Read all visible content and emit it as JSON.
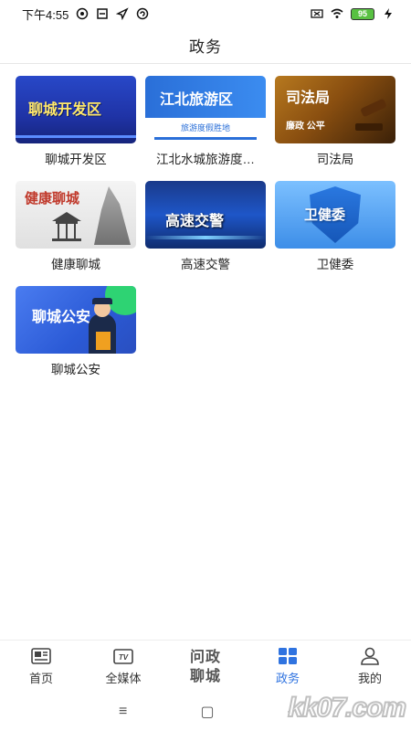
{
  "status_bar": {
    "time": "下午4:55",
    "battery": "95"
  },
  "header": {
    "title": "政务"
  },
  "tiles": [
    {
      "label": "聊城开发区",
      "thumb_text": "聊城开发区"
    },
    {
      "label": "江北水城旅游度…",
      "thumb_text": "江北旅游区",
      "thumb_sub": "旅游度假胜地"
    },
    {
      "label": "司法局",
      "thumb_text": "司法局",
      "thumb_sub": "廉政  公平"
    },
    {
      "label": "健康聊城",
      "thumb_text": "健康聊城"
    },
    {
      "label": "高速交警",
      "thumb_text": "高速交警"
    },
    {
      "label": "卫健委",
      "thumb_text": "卫健委"
    },
    {
      "label": "聊城公安",
      "thumb_text": "聊城公安"
    }
  ],
  "bottom_nav": {
    "items": [
      {
        "label": "首页",
        "icon": "news-icon"
      },
      {
        "label": "全媒体",
        "icon": "tv-icon"
      },
      {
        "label": "问政聊城",
        "icon": "center-logo"
      },
      {
        "label": "政务",
        "icon": "grid-icon",
        "active": true
      },
      {
        "label": "我的",
        "icon": "user-icon"
      }
    ],
    "center_line1": "问政",
    "center_line2": "聊城",
    "active_color": "#2f73e0"
  },
  "watermark": "kk07.com"
}
